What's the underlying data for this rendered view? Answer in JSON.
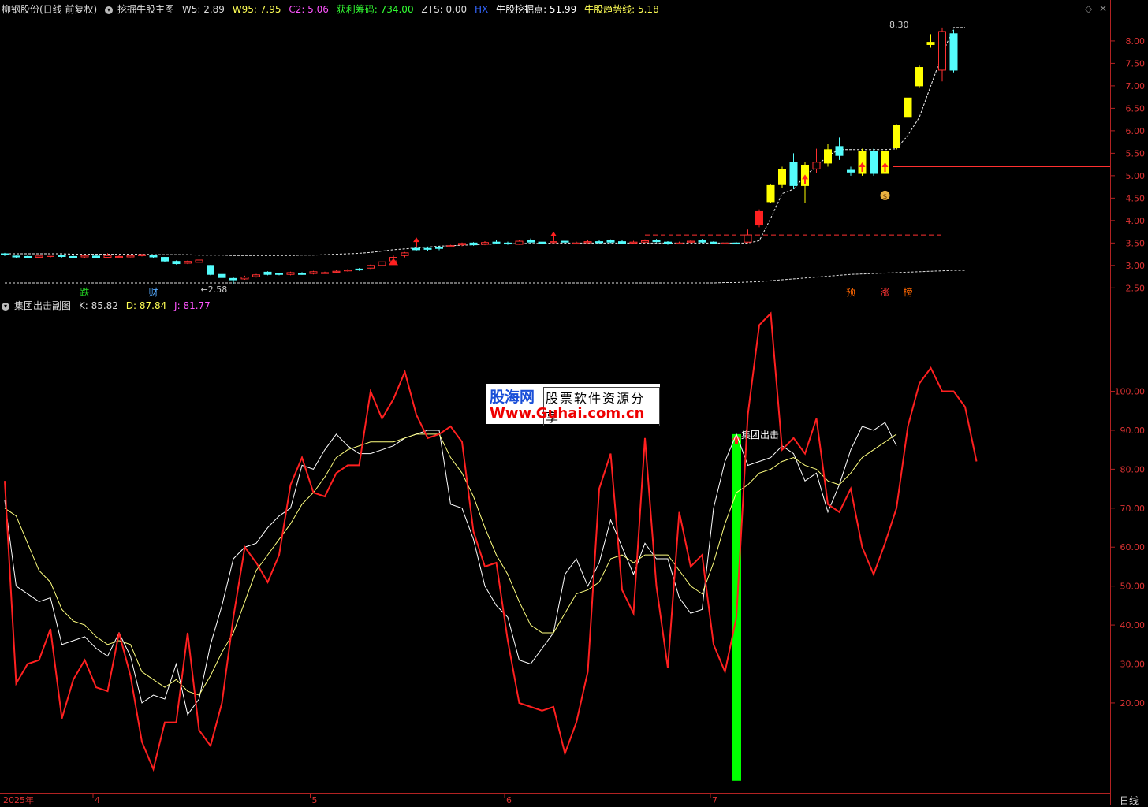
{
  "header": {
    "stock": "柳钢股份(日线 前复权)",
    "indicator": "挖掘牛股主图",
    "w5_label": "W5: 2.89",
    "w95_label": "W95: 7.95",
    "c2_label": "C2: 5.06",
    "profit_label": "获利筹码: 734.00",
    "zts_label": "ZTS: 0.00",
    "hx_label": "HX",
    "dig_label": "牛股挖掘点: 51.99",
    "trend_label": "牛股趋势线: 5.18"
  },
  "sub_header": {
    "name": "集团出击副图",
    "k_label": "K: 85.82",
    "d_label": "D: 87.84",
    "j_label": "J: 81.77"
  },
  "watermark": {
    "brand": "股海网",
    "slogan": "股票软件资源分享",
    "url": "Www.Guhai.com.cn"
  },
  "footer": {
    "period_label": "日线"
  },
  "colors": {
    "up": "#ff3030",
    "down": "#54fcfc",
    "yellow_bar": "#ffff00",
    "k_line": "#ffffff",
    "d_line": "#ffff7f",
    "j_line": "#ff2020",
    "signal_bar": "#00ff00",
    "axis": "#b22222"
  },
  "chart_data": [
    {
      "type": "candlestick",
      "title": "挖掘牛股主图",
      "y_ticks": [
        "8.00",
        "7.50",
        "7.00",
        "6.50",
        "6.00",
        "5.50",
        "5.00",
        "4.50",
        "4.00",
        "3.50",
        "3.00",
        "2.50"
      ],
      "ylim": [
        2.33,
        8.56
      ],
      "x_ticks": [
        {
          "i": 8,
          "label": "4"
        },
        {
          "i": 27,
          "label": "5"
        },
        {
          "i": 44,
          "label": "6"
        },
        {
          "i": 62,
          "label": "7"
        }
      ],
      "first_label": "2025年",
      "annotations": [
        {
          "i": 17,
          "value": 2.58,
          "text": "←2.58"
        },
        {
          "i": 80,
          "value": 8.3,
          "text": "8.30"
        }
      ],
      "bottom_markers": [
        {
          "i": 7,
          "text": "跌",
          "color": "#22cc22"
        },
        {
          "i": 13,
          "text": "财",
          "color": "#55aaff"
        },
        {
          "i": 74,
          "text": "预",
          "color": "#ff6600"
        },
        {
          "i": 77,
          "text": "涨",
          "color": "#ff3333"
        },
        {
          "i": 79,
          "text": "榜",
          "color": "#ff6600"
        }
      ],
      "hline": {
        "from": 78,
        "value": 5.2,
        "color": "#ff3030"
      },
      "candles": [
        [
          3.26,
          3.24,
          3.28,
          3.21
        ],
        [
          3.21,
          3.19,
          3.22,
          3.17
        ],
        [
          3.2,
          3.18,
          3.22,
          3.16
        ],
        [
          3.18,
          3.21,
          3.23,
          3.16
        ],
        [
          3.2,
          3.23,
          3.25,
          3.18
        ],
        [
          3.22,
          3.2,
          3.24,
          3.18
        ],
        [
          3.2,
          3.19,
          3.22,
          3.17
        ],
        [
          3.19,
          3.22,
          3.24,
          3.17
        ],
        [
          3.21,
          3.18,
          3.23,
          3.16
        ],
        [
          3.18,
          3.22,
          3.27,
          3.17
        ],
        [
          3.2,
          3.2,
          3.23,
          3.18
        ],
        [
          3.19,
          3.22,
          3.24,
          3.18
        ],
        [
          3.22,
          3.24,
          3.26,
          3.2
        ],
        [
          3.22,
          3.19,
          3.24,
          3.17
        ],
        [
          3.18,
          3.1,
          3.19,
          3.08
        ],
        [
          3.09,
          3.04,
          3.11,
          3.02
        ],
        [
          3.05,
          3.09,
          3.11,
          3.03
        ],
        [
          3.07,
          3.12,
          3.14,
          3.05
        ],
        [
          3.0,
          2.8,
          3.01,
          2.78
        ],
        [
          2.8,
          2.73,
          2.82,
          2.7
        ],
        [
          2.71,
          2.68,
          2.74,
          2.58
        ],
        [
          2.7,
          2.74,
          2.77,
          2.68
        ],
        [
          2.75,
          2.79,
          2.81,
          2.73
        ],
        [
          2.85,
          2.8,
          2.87,
          2.78
        ],
        [
          2.82,
          2.81,
          2.84,
          2.78
        ],
        [
          2.8,
          2.84,
          2.86,
          2.78
        ],
        [
          2.82,
          2.81,
          2.85,
          2.79
        ],
        [
          2.82,
          2.86,
          2.88,
          2.8
        ],
        [
          2.84,
          2.84,
          2.86,
          2.82
        ],
        [
          2.85,
          2.87,
          2.9,
          2.83
        ],
        [
          2.88,
          2.9,
          2.92,
          2.86
        ],
        [
          2.92,
          2.9,
          2.94,
          2.88
        ],
        [
          2.94,
          3.0,
          3.02,
          2.92
        ],
        [
          3.0,
          3.08,
          3.1,
          2.98
        ],
        [
          3.1,
          3.18,
          3.22,
          3.06
        ],
        [
          3.22,
          3.28,
          3.3,
          3.18
        ],
        [
          3.38,
          3.35,
          3.4,
          3.32
        ],
        [
          3.38,
          3.36,
          3.42,
          3.32
        ],
        [
          3.4,
          3.38,
          3.43,
          3.34
        ],
        [
          3.42,
          3.44,
          3.46,
          3.4
        ],
        [
          3.46,
          3.49,
          3.51,
          3.43
        ],
        [
          3.5,
          3.46,
          3.52,
          3.44
        ],
        [
          3.47,
          3.51,
          3.54,
          3.45
        ],
        [
          3.52,
          3.5,
          3.56,
          3.47
        ],
        [
          3.5,
          3.48,
          3.53,
          3.46
        ],
        [
          3.47,
          3.54,
          3.57,
          3.46
        ],
        [
          3.56,
          3.52,
          3.6,
          3.5
        ],
        [
          3.52,
          3.49,
          3.55,
          3.47
        ],
        [
          3.51,
          3.53,
          3.56,
          3.49
        ],
        [
          3.54,
          3.52,
          3.57,
          3.5
        ],
        [
          3.49,
          3.5,
          3.53,
          3.47
        ],
        [
          3.51,
          3.53,
          3.56,
          3.48
        ],
        [
          3.53,
          3.52,
          3.56,
          3.49
        ],
        [
          3.55,
          3.52,
          3.58,
          3.5
        ],
        [
          3.53,
          3.49,
          3.56,
          3.47
        ],
        [
          3.5,
          3.52,
          3.55,
          3.48
        ],
        [
          3.52,
          3.55,
          3.58,
          3.5
        ],
        [
          3.56,
          3.53,
          3.59,
          3.51
        ],
        [
          3.52,
          3.48,
          3.54,
          3.46
        ],
        [
          3.49,
          3.5,
          3.53,
          3.47
        ],
        [
          3.52,
          3.54,
          3.57,
          3.49
        ],
        [
          3.55,
          3.52,
          3.59,
          3.5
        ],
        [
          3.52,
          3.49,
          3.54,
          3.47
        ],
        [
          3.49,
          3.5,
          3.53,
          3.47
        ],
        [
          3.5,
          3.49,
          3.52,
          3.47
        ],
        [
          3.52,
          3.68,
          3.8,
          3.5
        ],
        [
          3.9,
          4.2,
          4.25,
          3.85
        ],
        [
          4.42,
          4.78,
          4.8,
          4.4
        ],
        [
          4.8,
          5.14,
          5.2,
          4.72
        ],
        [
          5.3,
          4.78,
          5.5,
          4.7
        ],
        [
          4.78,
          5.22,
          5.3,
          4.4
        ],
        [
          5.15,
          5.3,
          5.6,
          5.05
        ],
        [
          5.28,
          5.58,
          5.7,
          5.2
        ],
        [
          5.65,
          5.45,
          5.85,
          5.35
        ],
        [
          5.12,
          5.08,
          5.2,
          5.0
        ],
        [
          5.05,
          5.55,
          5.6,
          5.0
        ],
        [
          5.55,
          5.05,
          5.6,
          5.0
        ],
        [
          5.05,
          5.55,
          5.6,
          5.0
        ],
        [
          5.62,
          6.12,
          6.15,
          5.58
        ],
        [
          6.3,
          6.73,
          6.75,
          6.25
        ],
        [
          7.0,
          7.41,
          7.45,
          6.95
        ],
        [
          7.92,
          7.97,
          8.15,
          7.85
        ],
        [
          7.35,
          8.21,
          8.3,
          7.1
        ],
        [
          8.16,
          7.35,
          8.25,
          7.3
        ]
      ],
      "yellow_bars": [
        66,
        67,
        68,
        70,
        72,
        75,
        77,
        78,
        79,
        80,
        81
      ],
      "red_box_bar": 66,
      "up_arrows": [
        36,
        48,
        70,
        75,
        77
      ],
      "triangles": [
        34
      ],
      "bag": 77,
      "trend_line": [
        3.26,
        3.26,
        3.26,
        3.26,
        3.26,
        3.26,
        3.25,
        3.25,
        3.25,
        3.25,
        3.25,
        3.25,
        3.25,
        3.24,
        3.24,
        3.24,
        3.24,
        3.23,
        3.23,
        3.23,
        3.22,
        3.22,
        3.22,
        3.22,
        3.22,
        3.22,
        3.23,
        3.23,
        3.24,
        3.25,
        3.26,
        3.27,
        3.29,
        3.32,
        3.35,
        3.37,
        3.39,
        3.41,
        3.43,
        3.44,
        3.45,
        3.46,
        3.47,
        3.48,
        3.48,
        3.49,
        3.49,
        3.49,
        3.5,
        3.5,
        3.5,
        3.5,
        3.5,
        3.5,
        3.5,
        3.5,
        3.5,
        3.5,
        3.5,
        3.5,
        3.5,
        3.5,
        3.5,
        3.5,
        3.5,
        3.5,
        3.55,
        4.05,
        4.6,
        4.7,
        5.0,
        5.2,
        5.45,
        5.58,
        5.58,
        5.58,
        5.58,
        5.58,
        5.6,
        5.9,
        6.3,
        7.0,
        7.7,
        8.3,
        8.3
      ],
      "dash_red": {
        "from": 56,
        "to": 82,
        "value": 3.68
      },
      "bottom_line": [
        2.61,
        2.61,
        2.61,
        2.61,
        2.61,
        2.61,
        2.61,
        2.61,
        2.61,
        2.61,
        2.61,
        2.61,
        2.61,
        2.61,
        2.61,
        2.61,
        2.61,
        2.61,
        2.61,
        2.61,
        2.61,
        2.61,
        2.61,
        2.61,
        2.61,
        2.61,
        2.61,
        2.61,
        2.61,
        2.61,
        2.61,
        2.61,
        2.61,
        2.61,
        2.61,
        2.61,
        2.61,
        2.61,
        2.61,
        2.61,
        2.61,
        2.61,
        2.61,
        2.61,
        2.61,
        2.61,
        2.61,
        2.61,
        2.61,
        2.61,
        2.61,
        2.61,
        2.61,
        2.61,
        2.61,
        2.61,
        2.61,
        2.61,
        2.61,
        2.61,
        2.61,
        2.61,
        2.61,
        2.62,
        2.62,
        2.63,
        2.64,
        2.66,
        2.68,
        2.7,
        2.72,
        2.74,
        2.76,
        2.78,
        2.8,
        2.81,
        2.82,
        2.83,
        2.84,
        2.85,
        2.86,
        2.87,
        2.88,
        2.89,
        2.89
      ]
    },
    {
      "type": "line",
      "title": "集团出击副图",
      "y_ticks": [
        "100.00",
        "90.00",
        "80.00",
        "70.00",
        "60.00",
        "50.00",
        "40.00",
        "30.00",
        "20.00"
      ],
      "ylim": [
        -2.47,
        120.54
      ],
      "signal": {
        "i": 64,
        "from": 0,
        "to": 89,
        "label": "集团出击"
      },
      "series": [
        {
          "name": "K",
          "color": "#ffffff",
          "values": [
            72,
            50,
            48,
            46,
            47,
            35,
            36,
            37,
            34,
            32,
            38,
            32,
            20,
            22,
            21,
            30,
            17,
            21,
            35,
            45,
            57,
            60,
            61,
            65,
            68,
            70,
            81,
            80,
            85,
            89,
            86,
            84,
            84,
            85,
            86,
            88,
            89,
            90,
            90,
            71,
            70,
            62,
            50,
            45,
            42,
            31,
            30,
            34,
            38,
            53,
            57,
            50,
            56,
            67,
            60,
            53,
            61,
            57,
            57,
            47,
            43,
            44,
            70,
            82,
            89,
            81,
            82,
            83,
            86,
            84,
            77,
            79,
            69,
            76,
            85,
            91,
            90,
            92,
            86
          ]
        },
        {
          "name": "D",
          "color": "#ffff7f",
          "values": [
            70,
            68,
            61,
            54,
            51,
            44,
            41,
            40,
            37,
            35,
            36,
            35,
            28,
            26,
            24,
            26,
            23,
            22,
            27,
            33,
            38,
            46,
            54,
            58,
            62,
            66,
            71,
            74,
            78,
            83,
            85,
            86,
            87,
            87,
            87,
            88,
            89,
            89,
            89,
            83,
            79,
            73,
            65,
            58,
            53,
            46,
            40,
            38,
            38,
            43,
            48,
            49,
            51,
            57,
            58,
            56,
            58,
            58,
            58,
            54,
            50,
            48,
            56,
            66,
            74,
            76,
            79,
            80,
            82,
            83,
            81,
            80,
            77,
            76,
            79,
            83,
            85,
            87,
            89
          ]
        },
        {
          "name": "J",
          "color": "#ff2020",
          "values": [
            77,
            25,
            30,
            31,
            39,
            16,
            26,
            31,
            24,
            23,
            38,
            27,
            10,
            3,
            15,
            15,
            38,
            13,
            9,
            20,
            42,
            60,
            56,
            51,
            58,
            76,
            83,
            74,
            73,
            79,
            81,
            81,
            100,
            93,
            98,
            105,
            94,
            88,
            89,
            91,
            87,
            64,
            55,
            56,
            36,
            20,
            19,
            18,
            19,
            7,
            15,
            28,
            75,
            84,
            49,
            43,
            88,
            50,
            29,
            69,
            55,
            58,
            35,
            28,
            42,
            94,
            117,
            120,
            85,
            88,
            84,
            93,
            71,
            69,
            75,
            60,
            53,
            61,
            70,
            91,
            102,
            106,
            100,
            100,
            96,
            82
          ]
        }
      ]
    }
  ]
}
